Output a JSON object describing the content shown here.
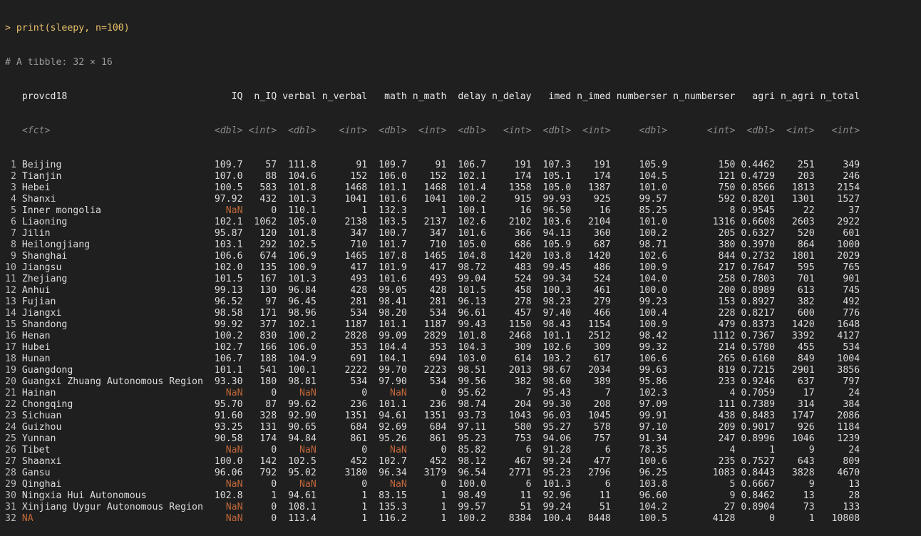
{
  "console": {
    "command": "> print(sleepy, n=100)",
    "tibble_info": "# A tibble: 32 × 16",
    "columns": [
      "provcd18",
      "IQ",
      "n_IQ",
      "verbal",
      "n_verbal",
      "math",
      "n_math",
      "delay",
      "n_delay",
      "imed",
      "n_imed",
      "numberser",
      "n_numberser",
      "agri",
      "n_agri",
      "n_total"
    ],
    "types": [
      "<fct>",
      "<dbl>",
      "<int>",
      "<dbl>",
      "<int>",
      "<dbl>",
      "<int>",
      "<dbl>",
      "<int>",
      "<dbl>",
      "<int>",
      "<dbl>",
      "<int>",
      "<dbl>",
      "<int>",
      "<int>"
    ],
    "rows": [
      [
        "Beijing",
        "109.7",
        "57",
        "111.8",
        "91",
        "109.7",
        "91",
        "106.7",
        "191",
        "107.3",
        "191",
        "105.9",
        "150",
        "0.4462",
        "251",
        "349"
      ],
      [
        "Tianjin",
        "107.0",
        "88",
        "104.6",
        "152",
        "106.0",
        "152",
        "102.1",
        "174",
        "105.1",
        "174",
        "104.5",
        "121",
        "0.4729",
        "203",
        "246"
      ],
      [
        "Hebei",
        "100.5",
        "583",
        "101.8",
        "1468",
        "101.1",
        "1468",
        "101.4",
        "1358",
        "105.0",
        "1387",
        "101.0",
        "750",
        "0.8566",
        "1813",
        "2154"
      ],
      [
        "Shanxi",
        "97.92",
        "432",
        "101.3",
        "1041",
        "101.6",
        "1041",
        "100.2",
        "915",
        "99.93",
        "925",
        "99.57",
        "592",
        "0.8201",
        "1301",
        "1527"
      ],
      [
        "Inner mongolia",
        "NaN",
        "0",
        "110.1",
        "1",
        "132.3",
        "1",
        "100.1",
        "16",
        "96.50",
        "16",
        "85.25",
        "8",
        "0.9545",
        "22",
        "37"
      ],
      [
        "Liaoning",
        "102.1",
        "1062",
        "105.0",
        "2138",
        "103.5",
        "2137",
        "102.6",
        "2102",
        "103.6",
        "2104",
        "101.0",
        "1316",
        "0.6608",
        "2603",
        "2922"
      ],
      [
        "Jilin",
        "95.87",
        "120",
        "101.8",
        "347",
        "100.7",
        "347",
        "101.6",
        "366",
        "94.13",
        "360",
        "100.2",
        "205",
        "0.6327",
        "520",
        "601"
      ],
      [
        "Heilongjiang",
        "103.1",
        "292",
        "102.5",
        "710",
        "101.7",
        "710",
        "105.0",
        "686",
        "105.9",
        "687",
        "98.71",
        "380",
        "0.3970",
        "864",
        "1000"
      ],
      [
        "Shanghai",
        "106.6",
        "674",
        "106.9",
        "1465",
        "107.8",
        "1465",
        "104.8",
        "1420",
        "103.8",
        "1420",
        "102.6",
        "844",
        "0.2732",
        "1801",
        "2029"
      ],
      [
        "Jiangsu",
        "102.0",
        "135",
        "100.9",
        "417",
        "101.9",
        "417",
        "98.72",
        "483",
        "99.45",
        "486",
        "100.9",
        "217",
        "0.7647",
        "595",
        "765"
      ],
      [
        "Zhejiang",
        "101.5",
        "167",
        "101.3",
        "493",
        "101.6",
        "493",
        "99.04",
        "524",
        "99.34",
        "524",
        "104.0",
        "258",
        "0.7803",
        "701",
        "901"
      ],
      [
        "Anhui",
        "99.13",
        "130",
        "96.84",
        "428",
        "99.05",
        "428",
        "101.5",
        "458",
        "100.3",
        "461",
        "100.0",
        "200",
        "0.8989",
        "613",
        "745"
      ],
      [
        "Fujian",
        "96.52",
        "97",
        "96.45",
        "281",
        "98.41",
        "281",
        "96.13",
        "278",
        "98.23",
        "279",
        "99.23",
        "153",
        "0.8927",
        "382",
        "492"
      ],
      [
        "Jiangxi",
        "98.58",
        "171",
        "98.96",
        "534",
        "98.20",
        "534",
        "96.61",
        "457",
        "97.40",
        "466",
        "100.4",
        "228",
        "0.8217",
        "600",
        "776"
      ],
      [
        "Shandong",
        "99.92",
        "377",
        "102.1",
        "1187",
        "101.1",
        "1187",
        "99.43",
        "1150",
        "98.43",
        "1154",
        "100.9",
        "479",
        "0.8373",
        "1420",
        "1648"
      ],
      [
        "Henan",
        "100.2",
        "830",
        "100.2",
        "2828",
        "99.09",
        "2829",
        "101.8",
        "2468",
        "101.1",
        "2512",
        "98.42",
        "1112",
        "0.7367",
        "3392",
        "4127"
      ],
      [
        "Hubei",
        "102.7",
        "166",
        "106.0",
        "353",
        "104.4",
        "353",
        "104.3",
        "309",
        "102.6",
        "309",
        "99.32",
        "214",
        "0.5780",
        "455",
        "534"
      ],
      [
        "Hunan",
        "106.7",
        "188",
        "104.9",
        "691",
        "104.1",
        "694",
        "103.0",
        "614",
        "103.2",
        "617",
        "106.6",
        "265",
        "0.6160",
        "849",
        "1004"
      ],
      [
        "Guangdong",
        "101.1",
        "541",
        "100.1",
        "2222",
        "99.70",
        "2223",
        "98.51",
        "2013",
        "98.67",
        "2034",
        "99.63",
        "819",
        "0.7215",
        "2901",
        "3856"
      ],
      [
        "Guangxi Zhuang Autonomous Region",
        "93.30",
        "180",
        "98.81",
        "534",
        "97.90",
        "534",
        "99.56",
        "382",
        "98.60",
        "389",
        "95.86",
        "233",
        "0.9246",
        "637",
        "797"
      ],
      [
        "Hainan",
        "NaN",
        "0",
        "NaN",
        "0",
        "NaN",
        "0",
        "95.62",
        "7",
        "95.43",
        "7",
        "102.3",
        "4",
        "0.7059",
        "17",
        "24"
      ],
      [
        "Chongqing",
        "95.70",
        "87",
        "99.62",
        "236",
        "101.1",
        "236",
        "98.74",
        "204",
        "99.30",
        "208",
        "97.09",
        "111",
        "0.7389",
        "314",
        "384"
      ],
      [
        "Sichuan",
        "91.60",
        "328",
        "92.90",
        "1351",
        "94.61",
        "1351",
        "93.73",
        "1043",
        "96.03",
        "1045",
        "99.91",
        "438",
        "0.8483",
        "1747",
        "2086"
      ],
      [
        "Guizhou",
        "93.25",
        "131",
        "90.65",
        "684",
        "92.69",
        "684",
        "97.11",
        "580",
        "95.27",
        "578",
        "97.10",
        "209",
        "0.9017",
        "926",
        "1184"
      ],
      [
        "Yunnan",
        "90.58",
        "174",
        "94.84",
        "861",
        "95.26",
        "861",
        "95.23",
        "753",
        "94.06",
        "757",
        "91.34",
        "247",
        "0.8996",
        "1046",
        "1239"
      ],
      [
        "Tibet",
        "NaN",
        "0",
        "NaN",
        "0",
        "NaN",
        "0",
        "85.82",
        "6",
        "91.28",
        "6",
        "78.35",
        "4",
        "1",
        "9",
        "24"
      ],
      [
        "Shaanxi",
        "100.0",
        "142",
        "102.5",
        "452",
        "102.7",
        "452",
        "98.12",
        "467",
        "99.24",
        "477",
        "100.6",
        "235",
        "0.7527",
        "643",
        "809"
      ],
      [
        "Gansu",
        "96.06",
        "792",
        "95.02",
        "3180",
        "96.34",
        "3179",
        "96.54",
        "2771",
        "95.23",
        "2796",
        "96.25",
        "1083",
        "0.8443",
        "3828",
        "4670"
      ],
      [
        "Qinghai",
        "NaN",
        "0",
        "NaN",
        "0",
        "NaN",
        "0",
        "100.0",
        "6",
        "101.3",
        "6",
        "103.8",
        "5",
        "0.6667",
        "9",
        "13"
      ],
      [
        "Ningxia Hui Autonomous",
        "102.8",
        "1",
        "94.61",
        "1",
        "83.15",
        "1",
        "98.49",
        "11",
        "92.96",
        "11",
        "96.60",
        "9",
        "0.8462",
        "13",
        "28"
      ],
      [
        "Xinjiang Uygur Autonomous Region",
        "NaN",
        "0",
        "108.1",
        "1",
        "135.3",
        "1",
        "99.57",
        "51",
        "99.24",
        "51",
        "104.2",
        "27",
        "0.8904",
        "73",
        "133"
      ],
      [
        "NA",
        "NaN",
        "0",
        "113.4",
        "1",
        "116.2",
        "1",
        "100.2",
        "8384",
        "100.4",
        "8448",
        "100.5",
        "4128",
        "0",
        "1",
        "10808"
      ]
    ]
  }
}
